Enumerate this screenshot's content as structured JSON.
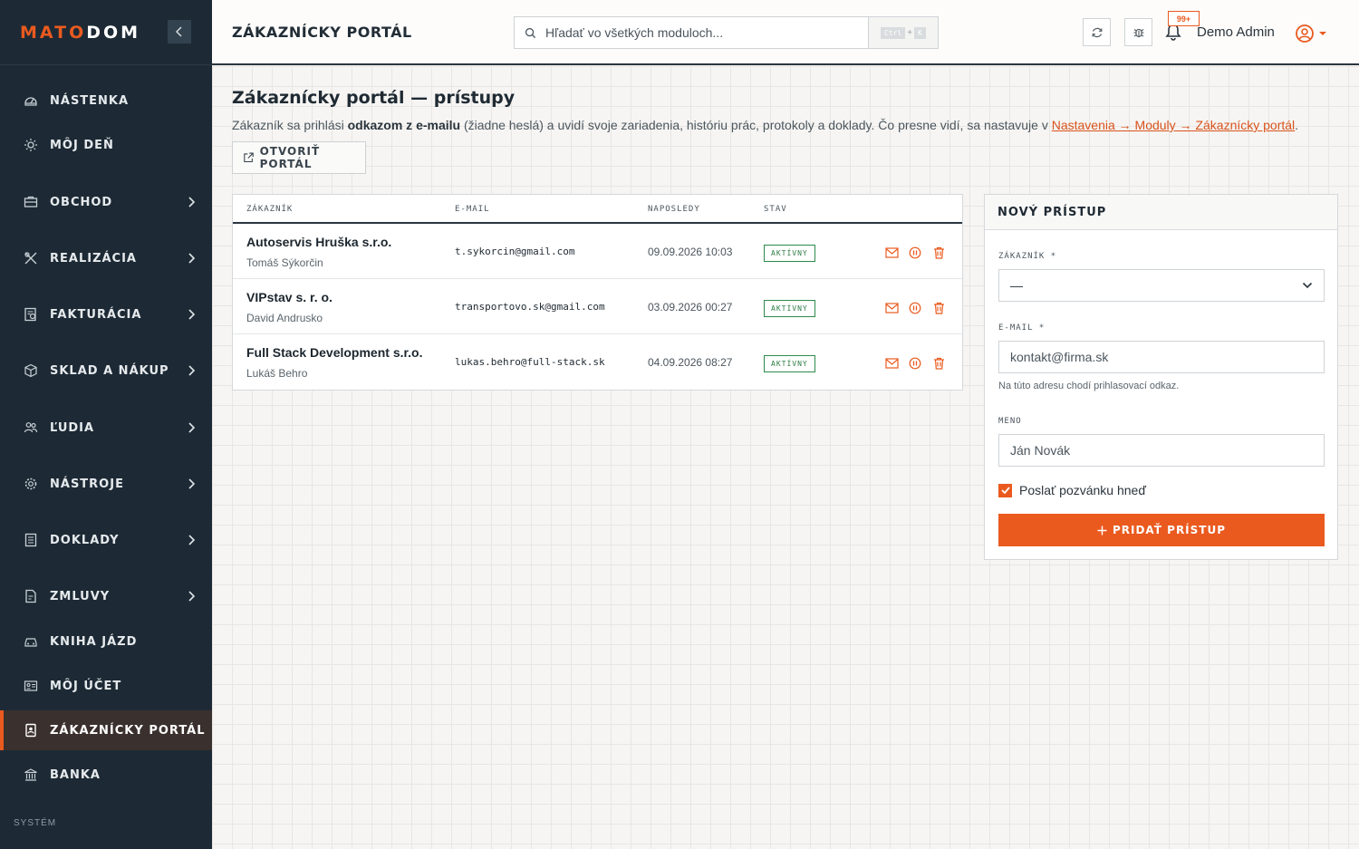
{
  "brand": {
    "logo_part1": "MATO",
    "logo_part2": "DOM"
  },
  "colors": {
    "accent": "#ea5a1f",
    "sidebar_bg": "#1d2a35",
    "status_green": "#2e7d45"
  },
  "sidebar": {
    "items": [
      {
        "label": "NÁSTENKA",
        "icon": "gauge-icon"
      },
      {
        "label": "MÔJ DEŇ",
        "icon": "sun-icon"
      },
      {
        "label": "OBCHOD",
        "icon": "briefcase-icon"
      },
      {
        "label": "REALIZÁCIA",
        "icon": "tools-icon"
      },
      {
        "label": "FAKTURÁCIA",
        "icon": "invoice-icon"
      },
      {
        "label": "SKLAD A NÁKUP",
        "icon": "box-icon"
      },
      {
        "label": "ĽUDIA",
        "icon": "users-icon"
      },
      {
        "label": "NÁSTROJE",
        "icon": "gear-icon"
      },
      {
        "label": "DOKLADY",
        "icon": "document-icon"
      },
      {
        "label": "ZMLUVY",
        "icon": "contract-icon"
      },
      {
        "label": "KNIHA JÁZD",
        "icon": "car-icon"
      },
      {
        "label": "MÔJ ÚČET",
        "icon": "id-card-icon"
      },
      {
        "label": "ZÁKAZNÍCKY PORTÁL",
        "icon": "portal-icon"
      },
      {
        "label": "BANKA",
        "icon": "bank-icon"
      }
    ],
    "section_label": "SYSTÉM"
  },
  "topbar": {
    "title": "ZÁKAZNÍCKY PORTÁL",
    "search_placeholder": "Hľadať vo všetkých moduloch...",
    "shortcut_key1": "Ctrl",
    "shortcut_plus": "+",
    "shortcut_key2": "K",
    "notif_badge": "99+",
    "user_name": "Demo Admin"
  },
  "page": {
    "title": "Zákaznícky portál — prístupy",
    "desc_part1": "Zákazník sa prihlási ",
    "desc_bold": "odkazom z e-mailu",
    "desc_part2": " (žiadne heslá) a uvidí svoje zariadenia, históriu prác, protokoly a doklady. Čo presne vidí, sa nastavuje v ",
    "desc_link": "Nastavenia → Moduly → Zákaznícky portál",
    "desc_end": ".",
    "open_button": "OTVORIŤ PORTÁL"
  },
  "table": {
    "headers": [
      "ZÁKAZNÍK",
      "E-MAIL",
      "NAPOSLEDY",
      "STAV"
    ],
    "rows": [
      {
        "name": "Autoservis Hruška s.r.o.",
        "contact": "Tomáš Sýkorčin",
        "email": "t.sykorcin@gmail.com",
        "last": "09.09.2026 10:03",
        "status": "AKTÍVNY"
      },
      {
        "name": "VIPstav s. r. o.",
        "contact": "David Andrusko",
        "email": "transportovo.sk@gmail.com",
        "last": "03.09.2026 00:27",
        "status": "AKTÍVNY"
      },
      {
        "name": "Full Stack Development s.r.o.",
        "contact": "Lukáš Behro",
        "email": "lukas.behro@full-stack.sk",
        "last": "04.09.2026 08:27",
        "status": "AKTÍVNY"
      }
    ]
  },
  "form": {
    "title": "NOVÝ PRÍSTUP",
    "customer_label": "ZÁKAZNÍK *",
    "customer_value": "—",
    "email_label": "E-MAIL *",
    "email_placeholder": "kontakt@firma.sk",
    "email_help": "Na túto adresu chodí prihlasovací odkaz.",
    "name_label": "MENO",
    "name_placeholder": "Ján Novák",
    "send_invite_label": "Poslať pozvánku hneď",
    "send_invite_checked": true,
    "submit_label": "PRIDAŤ PRÍSTUP"
  }
}
